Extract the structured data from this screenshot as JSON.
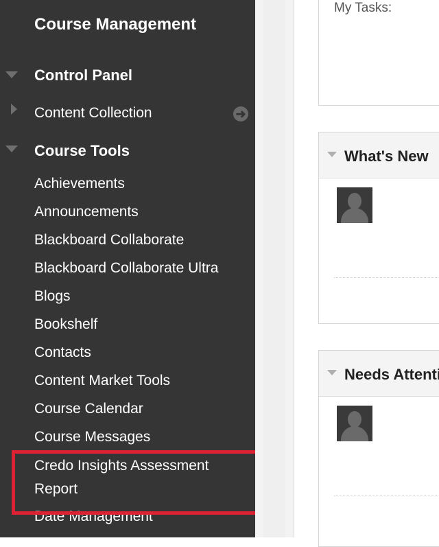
{
  "sidebar": {
    "title": "Course Management",
    "control_panel": "Control Panel",
    "content_collection": "Content Collection",
    "course_tools": "Course Tools",
    "items": [
      "Achievements",
      "Announcements",
      "Blackboard Collaborate",
      "Blackboard Collaborate Ultra",
      "Blogs",
      "Bookshelf",
      "Contacts",
      "Content Market Tools",
      "Course Calendar",
      "Course Messages",
      "Credo Insights Assessment Report",
      "Date Management"
    ]
  },
  "main": {
    "my_tasks": "My Tasks:",
    "panels": [
      {
        "title": "What's New"
      },
      {
        "title": "Needs Attention"
      }
    ]
  },
  "colors": {
    "sidebar_bg": "#353535",
    "highlight": "#dd2233"
  }
}
